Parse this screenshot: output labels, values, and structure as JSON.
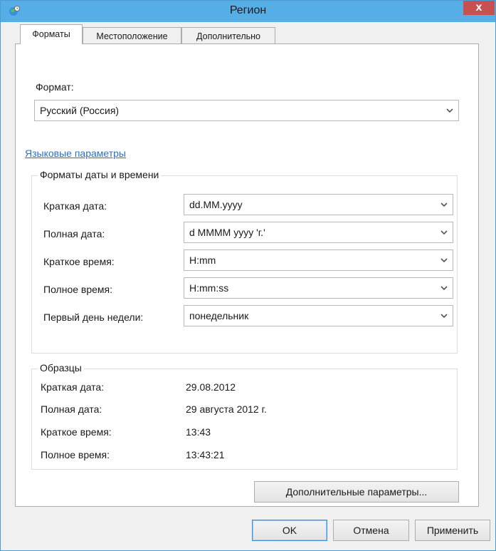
{
  "window": {
    "title": "Регион",
    "close_label": "x"
  },
  "tabs": [
    {
      "label": "Форматы",
      "active": true
    },
    {
      "label": "Местоположение",
      "active": false
    },
    {
      "label": "Дополнительно",
      "active": false
    }
  ],
  "format": {
    "label": "Формат:",
    "value": "Русский (Россия)"
  },
  "language_link": "Языковые параметры",
  "date_time_formats": {
    "group_title": "Форматы даты и времени",
    "rows": [
      {
        "label": "Краткая дата:",
        "value": "dd.MM.yyyy"
      },
      {
        "label": "Полная дата:",
        "value": "d MMMM yyyy 'г.'"
      },
      {
        "label": "Краткое время:",
        "value": "H:mm"
      },
      {
        "label": "Полное время:",
        "value": "H:mm:ss"
      },
      {
        "label": "Первый день недели:",
        "value": "понедельник"
      }
    ]
  },
  "samples": {
    "group_title": "Образцы",
    "rows": [
      {
        "label": "Краткая дата:",
        "value": "29.08.2012"
      },
      {
        "label": "Полная дата:",
        "value": "29 августа 2012 г."
      },
      {
        "label": "Краткое время:",
        "value": "13:43"
      },
      {
        "label": "Полное время:",
        "value": "13:43:21"
      }
    ]
  },
  "buttons": {
    "additional": "Дополнительные параметры...",
    "ok": "OK",
    "cancel": "Отмена",
    "apply": "Применить"
  }
}
